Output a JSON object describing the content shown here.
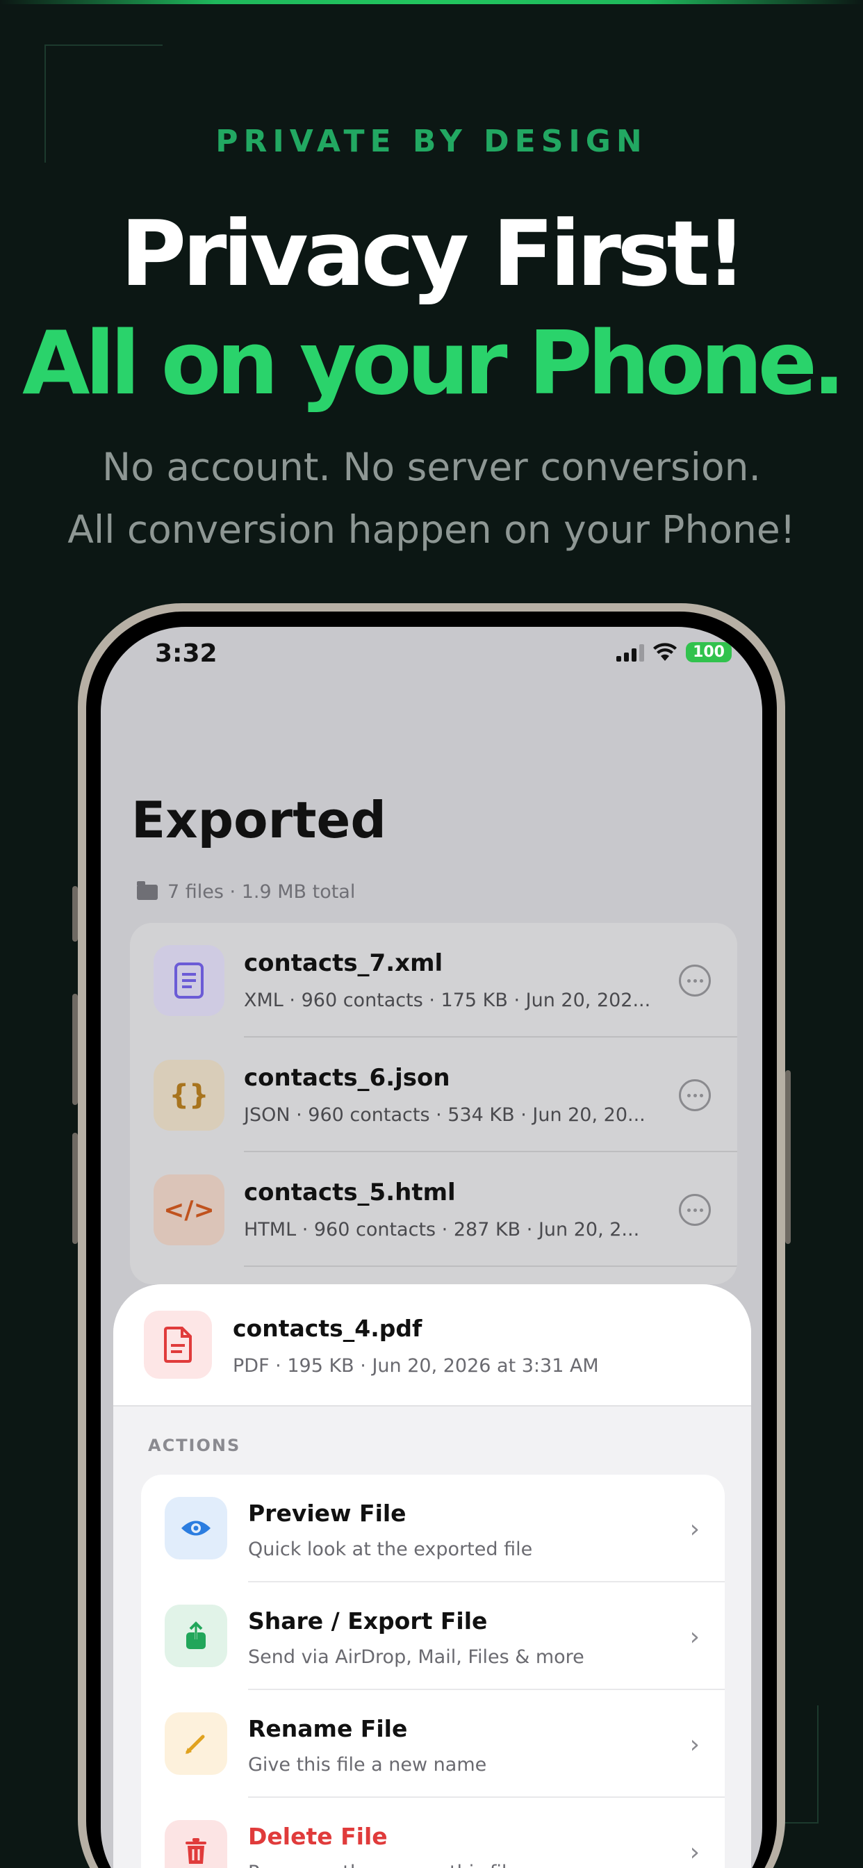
{
  "hero": {
    "eyebrow": "PRIVATE BY DESIGN",
    "headline_line1": "Privacy First!",
    "headline_line2": "All on your Phone.",
    "subtitle_line1": "No account. No server conversion.",
    "subtitle_line2": "All conversion happen on your Phone!"
  },
  "status_bar": {
    "time": "3:32",
    "battery": "100"
  },
  "screen": {
    "title": "Exported",
    "summary": "7 files · 1.9 MB total",
    "files": [
      {
        "name": "contacts_7.xml",
        "details": "XML · 960 contacts · 175 KB · Jun 20, 202...",
        "icon": "document-lines-icon",
        "glyph": "≡",
        "color": "#6b5bd6",
        "bg": "#cfcbe2"
      },
      {
        "name": "contacts_6.json",
        "details": "JSON · 960 contacts · 534 KB · Jun 20, 20...",
        "icon": "braces-icon",
        "glyph": "{}",
        "color": "#a8741e",
        "bg": "#d9cdb9"
      },
      {
        "name": "contacts_5.html",
        "details": "HTML · 960 contacts · 287 KB · Jun 20, 2...",
        "icon": "code-icon",
        "glyph": "</>",
        "color": "#c0521d",
        "bg": "#dbc4b8"
      }
    ]
  },
  "sheet": {
    "file_name": "contacts_4.pdf",
    "file_details": "PDF · 195 KB · Jun 20, 2026 at 3:31 AM",
    "actions_label": "ACTIONS",
    "actions": [
      {
        "title": "Preview File",
        "subtitle": "Quick look at the exported file",
        "icon": "eye-icon",
        "color": "#2b7de0",
        "bg": "#e1edfb"
      },
      {
        "title": "Share / Export File",
        "subtitle": "Send via AirDrop, Mail, Files & more",
        "icon": "share-icon",
        "color": "#21a65a",
        "bg": "#e1f3e8"
      },
      {
        "title": "Rename File",
        "subtitle": "Give this file a new name",
        "icon": "pencil-icon",
        "color": "#e0a21e",
        "bg": "#fdf1dc"
      },
      {
        "title": "Delete File",
        "subtitle": "Permanently remove this file",
        "icon": "trash-icon",
        "color": "#e03b3b",
        "bg": "#fce4e4"
      }
    ]
  }
}
